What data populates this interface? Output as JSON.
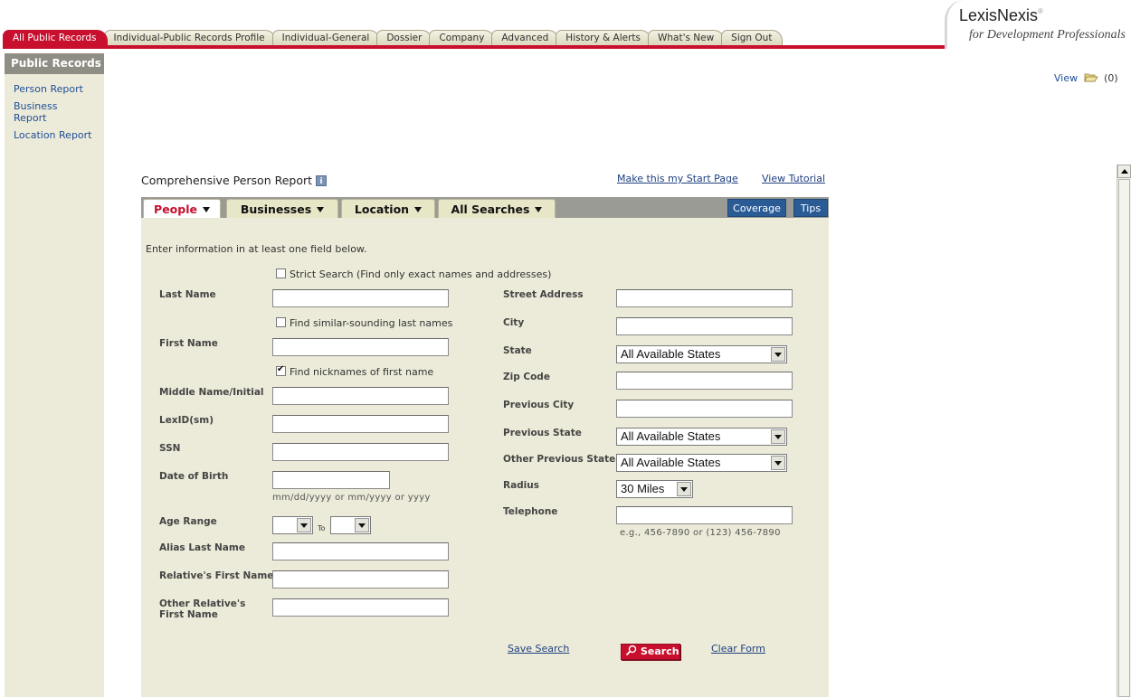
{
  "top_tabs": [
    "All Public Records",
    "Individual-Public Records Profile",
    "Individual-General",
    "Dossier",
    "Company",
    "Advanced",
    "History & Alerts",
    "What's New",
    "Sign Out"
  ],
  "logo": {
    "main": "LexisNexis",
    "reg": "®",
    "sub": "for Development Professionals"
  },
  "sidebar": {
    "title": "Public Records",
    "links": [
      "Person Report",
      "Business Report",
      "Location Report"
    ]
  },
  "view": {
    "label": "View",
    "count": "(0)"
  },
  "page": {
    "title": "Comprehensive Person Report",
    "info_icon": "i",
    "start_page_link": "Make this my Start Page",
    "tutorial_link": "View Tutorial"
  },
  "panel_tabs": [
    "People",
    "Businesses",
    "Location",
    "All Searches"
  ],
  "panel_buttons": {
    "coverage": "Coverage",
    "tips": "Tips"
  },
  "form": {
    "intro": "Enter information in at least one field below.",
    "strict_search": {
      "label": "Strict Search (Find only exact names and addresses)",
      "checked": false
    },
    "similar_sounding": {
      "label": "Find similar-sounding last names",
      "checked": false
    },
    "nicknames": {
      "label": "Find nicknames of first name",
      "checked": true
    },
    "labels": {
      "last_name": "Last Name",
      "first_name": "First Name",
      "middle_name": "Middle Name/Initial",
      "lexid": "LexID(sm)",
      "ssn": "SSN",
      "dob": "Date of Birth",
      "age_range": "Age Range",
      "alias_last_name": "Alias Last Name",
      "relatives_first_name": "Relative's First Name",
      "other_relatives_first_name": "Other Relative's First Name",
      "street_address": "Street Address",
      "city": "City",
      "state": "State",
      "zip_code": "Zip Code",
      "previous_city": "Previous City",
      "previous_state": "Previous State",
      "other_previous_state": "Other Previous State",
      "radius": "Radius",
      "telephone": "Telephone"
    },
    "values": {
      "last_name": "",
      "first_name": "",
      "middle_name": "",
      "lexid": "",
      "ssn": "",
      "dob": "",
      "alias_last_name": "",
      "relatives_first_name": "",
      "other_relatives_first_name": "",
      "street_address": "",
      "city": "",
      "zip_code": "",
      "previous_city": "",
      "telephone": ""
    },
    "selects": {
      "state": "All Available States",
      "previous_state": "All Available States",
      "other_previous_state": "All Available States",
      "radius": "30 Miles",
      "age_from": "",
      "age_to": ""
    },
    "to_label": "To",
    "dob_hint": "mm/dd/yyyy or mm/yyyy or yyyy",
    "phone_hint": "e.g., 456-7890 or (123) 456-7890",
    "save_search": "Save Search",
    "search_button": "Search",
    "clear_form": "Clear Form"
  }
}
